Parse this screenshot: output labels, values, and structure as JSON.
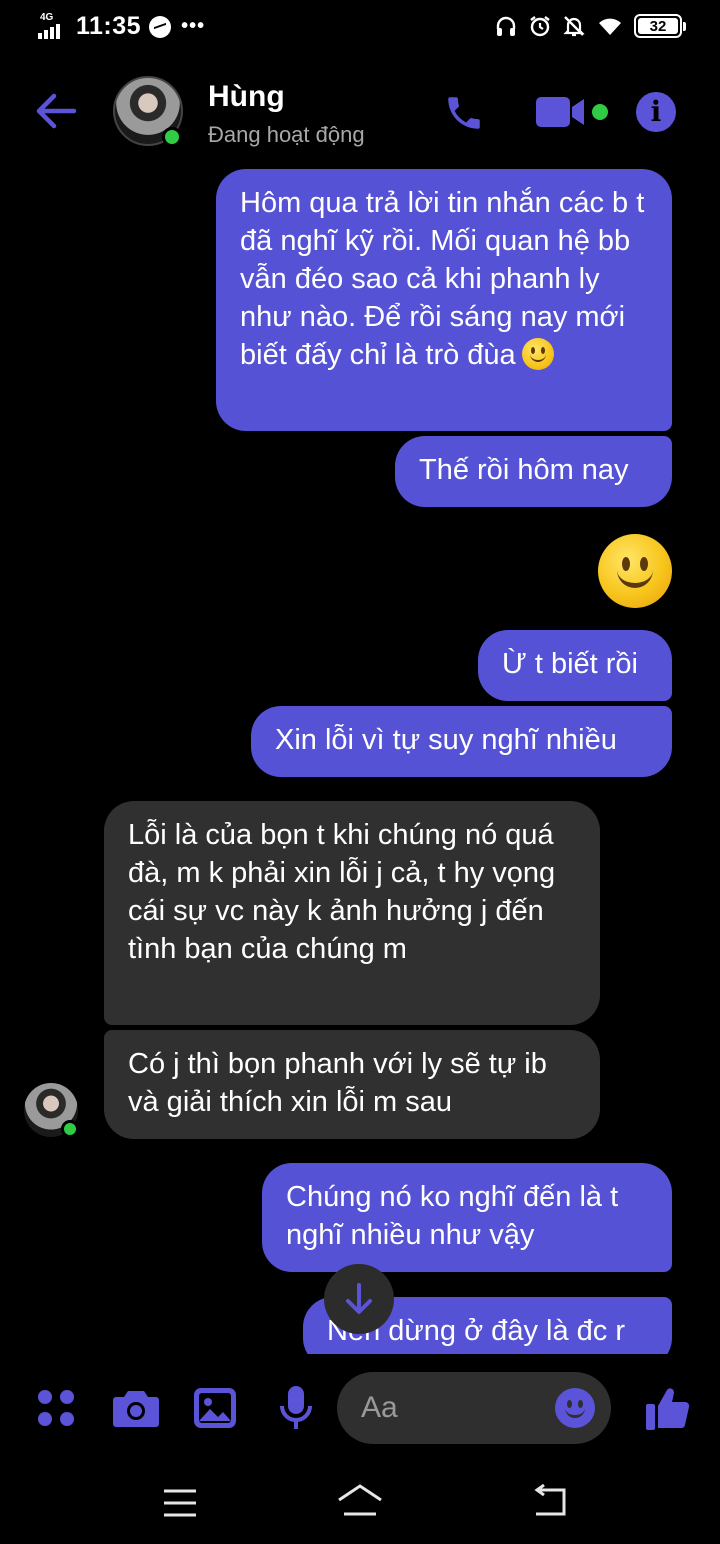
{
  "status_bar": {
    "network": "4G",
    "time": "11:35",
    "more": "•••",
    "battery": "32",
    "icons": [
      "headphones-icon",
      "alarm-icon",
      "mute-icon",
      "wifi-icon",
      "battery-icon"
    ]
  },
  "header": {
    "contact_name": "Hùng",
    "contact_status": "Đang hoạt động",
    "accent_color": "#5b54d8",
    "online_color": "#31cc46"
  },
  "messages": [
    {
      "side": "outgoing",
      "text": "Hôm qua trả lời tin nhắn các b t đã nghĩ kỹ rồi. Mối quan hệ bb vẫn đéo sao cả khi phanh ly như nào. Để rồi sáng nay mới biết đấy chỉ là trò đùa"
    },
    {
      "side": "outgoing",
      "text": "Thế rồi hôm nay"
    },
    {
      "side": "outgoing",
      "type": "emoji",
      "text": "smiley-emoji"
    },
    {
      "side": "outgoing",
      "text": "Ừ t biết rồi"
    },
    {
      "side": "outgoing",
      "text": "Xin lỗi vì tự suy nghĩ nhiều"
    },
    {
      "side": "incoming",
      "text": "Lỗi là của bọn t khi chúng nó quá đà, m k phải xin lỗi j cả, t hy vọng cái sự vc này k ảnh hưởng j đến tình bạn của chúng m"
    },
    {
      "side": "incoming",
      "text": "Có j thì bọn phanh với ly sẽ tự ib và giải thích xin lỗi m sau"
    },
    {
      "side": "outgoing",
      "text": "Chúng nó ko nghĩ đến là t nghĩ nhiều như vậy"
    },
    {
      "side": "outgoing",
      "text": "Nên dừng ở đây là đc r"
    }
  ],
  "composer": {
    "placeholder": "Aa",
    "icons": [
      "apps-icon",
      "camera-icon",
      "gallery-icon",
      "microphone-icon",
      "emoji-icon",
      "thumbs-up-icon"
    ]
  },
  "colors": {
    "outgoing_bubble": "#5552d6",
    "incoming_bubble": "#303030",
    "background": "#000000"
  }
}
